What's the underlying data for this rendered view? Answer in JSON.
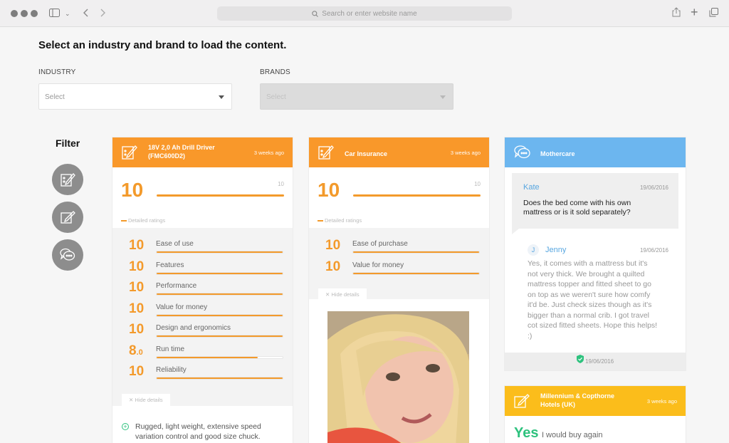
{
  "browser": {
    "url_placeholder": "Search or enter website name"
  },
  "page": {
    "title": "Select an industry and brand to load the content.",
    "industry": {
      "label": "INDUSTRY",
      "placeholder": "Select"
    },
    "brands": {
      "label": "BRANDS",
      "placeholder": "Select"
    },
    "filter_title": "Filter"
  },
  "colors": {
    "orange": "#f9982a",
    "blue": "#6cb6ef",
    "yellow": "#fbbd1b",
    "green": "#2ec27e"
  },
  "cards": {
    "drill": {
      "title_line1": "18V 2,0 Ah Drill Driver",
      "title_line2": "(FMC600D2)",
      "ago": "3 weeks ago",
      "score": "10",
      "max": "10",
      "score_fraction": 1.0,
      "detailed_label": "Detailed ratings",
      "ratings": [
        {
          "score": "10",
          "label": "Ease of use",
          "fraction": 1.0
        },
        {
          "score": "10",
          "label": "Features",
          "fraction": 1.0
        },
        {
          "score": "10",
          "label": "Performance",
          "fraction": 1.0
        },
        {
          "score": "10",
          "label": "Value for money",
          "fraction": 1.0
        },
        {
          "score": "10",
          "label": "Design and ergonomics",
          "fraction": 1.0
        },
        {
          "score": "8",
          "score_dec": ".0",
          "label": "Run time",
          "fraction": 0.8
        },
        {
          "score": "10",
          "label": "Reliability",
          "fraction": 1.0
        }
      ],
      "hide_details": "Hide details",
      "pro_text_line1": "Rugged, light weight, extensive speed",
      "pro_text_line2": "variation control and good size chuck."
    },
    "insurance": {
      "title": "Car Insurance",
      "ago": "3 weeks ago",
      "score": "10",
      "max": "10",
      "score_fraction": 1.0,
      "detailed_label": "Detailed ratings",
      "ratings": [
        {
          "score": "10",
          "label": "Ease of purchase",
          "fraction": 1.0
        },
        {
          "score": "10",
          "label": "Value for money",
          "fraction": 1.0
        }
      ],
      "hide_details": "Hide details"
    },
    "mothercare": {
      "title": "Mothercare",
      "question": {
        "author": "Kate",
        "date": "19/06/2016",
        "text_line1": "Does the bed come with his own",
        "text_line2": "mattress or is it sold separately?"
      },
      "answer": {
        "avatar_initial": "J",
        "author": "Jenny",
        "date": "19/06/2016",
        "lines": [
          "Yes, it comes with a mattress but it's",
          "not very thick. We brought a quilted",
          "mattress topper and fitted sheet to go",
          "on top as we weren't sure how comfy",
          "it'd be. Just check sizes though as it's",
          "bigger than a normal crib. I got travel",
          "cot sized fitted sheets. Hope this helps!",
          ":)"
        ]
      },
      "verified_date": "19/06/2016"
    },
    "millennium": {
      "title_line1": "Millennium & Copthorne",
      "title_line2": "Hotels (UK)",
      "ago": "3 weeks ago",
      "verdict": "Yes",
      "verdict_text": "I would buy again"
    }
  }
}
